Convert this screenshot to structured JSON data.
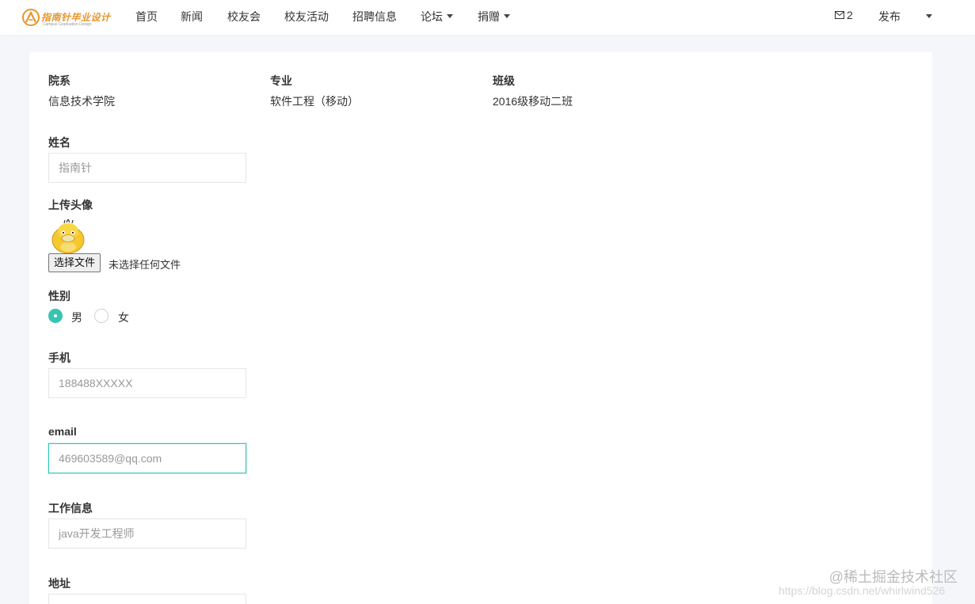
{
  "nav": {
    "logo_title": "指南针毕业设计",
    "logo_sub": "Campus Graduation Design",
    "items": [
      "首页",
      "新闻",
      "校友会",
      "校友活动",
      "招聘信息",
      "论坛",
      "捐赠"
    ],
    "mail_count": "2",
    "publish": "发布"
  },
  "form": {
    "dept_label": "院系",
    "dept_value": "信息技术学院",
    "major_label": "专业",
    "major_value": "软件工程（移动）",
    "class_label": "班级",
    "class_value": "2016级移动二班",
    "name_label": "姓名",
    "name_value": "指南针",
    "avatar_label": "上传头像",
    "file_button": "选择文件",
    "file_status": "未选择任何文件",
    "gender_label": "性别",
    "gender_male": "男",
    "gender_female": "女",
    "phone_label": "手机",
    "phone_value": "188488XXXXX",
    "email_label": "email",
    "email_value": "469603589@qq.com",
    "job_label": "工作信息",
    "job_value": "java开发工程师",
    "address_label": "地址",
    "address_value": ""
  },
  "watermark": {
    "text": "@稀土掘金技术社区",
    "url": "https://blog.csdn.net/whirlwind526"
  },
  "colors": {
    "accent": "#38c4b4",
    "logo": "#e8952b",
    "background": "#f5f6fa"
  }
}
